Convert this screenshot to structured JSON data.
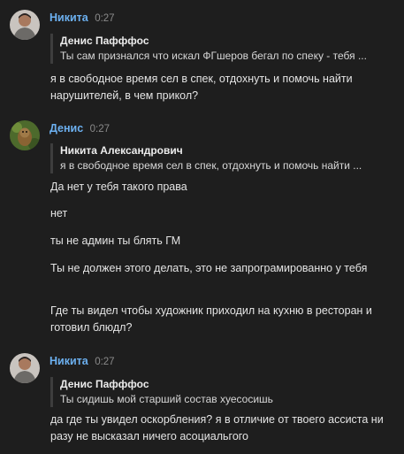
{
  "messages": [
    {
      "author": "Никита",
      "time": "0:27",
      "avatar": "avatar-photo-man",
      "reply": {
        "author": "Денис Пафффос",
        "text": "Ты сам признался что искал ФГшеров бегал по спеку - тебя ..."
      },
      "lines": [
        "я в свободное время сел в спек, отдохнуть и помочь найти нарушителей, в чем прикол?"
      ]
    },
    {
      "author": "Денис",
      "time": "0:27",
      "avatar": "avatar-photo-monkey",
      "reply": {
        "author": "Никита Александрович",
        "text": "я в свободное время сел в спек, отдохнуть и помочь найти ..."
      },
      "lines": [
        "Да нет у тебя такого права",
        "нет",
        "ты не админ ты блять ГМ",
        "Ты не должен этого делать, это не запрограмированно у тебя",
        "Где ты видел чтобы художник приходил на кухню в ресторан и готовил блюдл?"
      ]
    },
    {
      "author": "Никита",
      "time": "0:27",
      "avatar": "avatar-photo-man",
      "reply": {
        "author": "Денис Пафффос",
        "text": "Ты сидишь мой старший состав хуесосишь"
      },
      "lines": [
        "да где ты увидел оскорбления? я в отличие от твоего ассиста ни разу не высказал ничего асоциальгого"
      ]
    }
  ],
  "colors": {
    "background": "#1e1e1e",
    "author_name": "#6cb0f0",
    "timestamp": "#8a8a8a",
    "reply_bar": "#3d3d3d",
    "message_text": "#e4e4e4"
  }
}
